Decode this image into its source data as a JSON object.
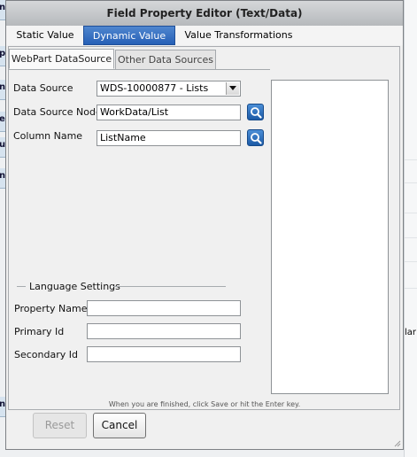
{
  "background": {
    "left_fragments": [
      "n",
      "p",
      "n",
      "e",
      "u",
      "n",
      "n"
    ],
    "right_fragment": "lar"
  },
  "dialog": {
    "title": "Field Property Editor (Text/Data)",
    "main_tabs": [
      {
        "label": "Static Value",
        "active": false
      },
      {
        "label": "Dynamic Value",
        "active": true
      },
      {
        "label": "Value Transformations",
        "active": false
      }
    ],
    "sub_tabs": [
      {
        "label": "WebPart DataSource",
        "active": true
      },
      {
        "label": "Other Data Sources",
        "active": false
      }
    ],
    "form": {
      "data_source": {
        "label": "Data Source",
        "value": "WDS-10000877 - Lists"
      },
      "data_source_node": {
        "label": "Data Source Node",
        "value": "WorkData/List"
      },
      "column_name": {
        "label": "Column Name",
        "value": "ListName"
      }
    },
    "language_settings": {
      "legend": "Language Settings",
      "property_name": {
        "label": "Property Name",
        "value": ""
      },
      "primary_id": {
        "label": "Primary Id",
        "value": ""
      },
      "secondary_id": {
        "label": "Secondary Id",
        "value": ""
      }
    },
    "hint": "When you are finished, click Save or hit the Enter key.",
    "buttons": {
      "reset": "Reset",
      "cancel": "Cancel"
    },
    "colors": {
      "active_tab": "#2f6cc0",
      "lookup_button": "#2a6fc0"
    }
  }
}
